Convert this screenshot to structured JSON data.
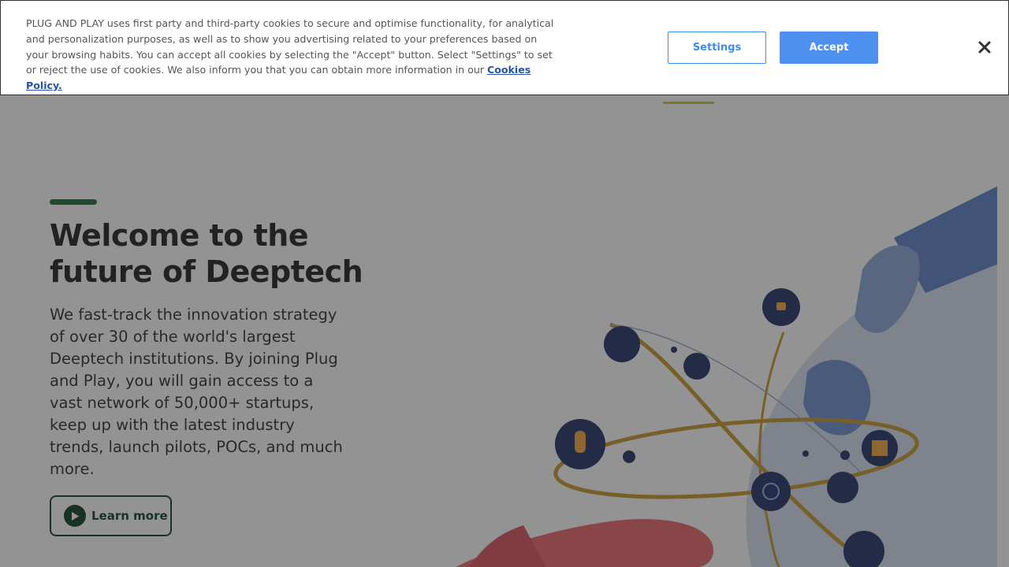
{
  "colors": {
    "brand_green": "#0d3d1e",
    "accent_green": "#1a6b36",
    "nav_active": "#c8c72c",
    "accept_blue": "#4d90f0",
    "settings_blue": "#3c8dee",
    "link_blue": "#2653a3"
  },
  "cookie_banner": {
    "text": "PLUG AND PLAY uses first party and third-party cookies to secure and optimise functionality, for analytical and personalization purposes, as well as to show you advertising related to your preferences based on your browsing habits. You can accept all cookies by selecting the \"Accept\" button. Select \"Settings\" to set or reject the use of cookies. We also inform you that you can obtain more information in our",
    "policy_link": "Cookies Policy.",
    "settings_label": "Settings",
    "accept_label": "Accept",
    "close_icon": "close-icon"
  },
  "hero": {
    "title": "Welcome to the future of Deeptech",
    "description": "We fast-track the innovation strategy of over 30 of the world's largest Deeptech institutions. By joining Plug and Play, you will gain access to a vast network of 50,000+ startups, keep up with the latest industry trends, launch pilots, POCs, and much more.",
    "cta_label": "Learn more",
    "cta_icon": "play-icon"
  }
}
